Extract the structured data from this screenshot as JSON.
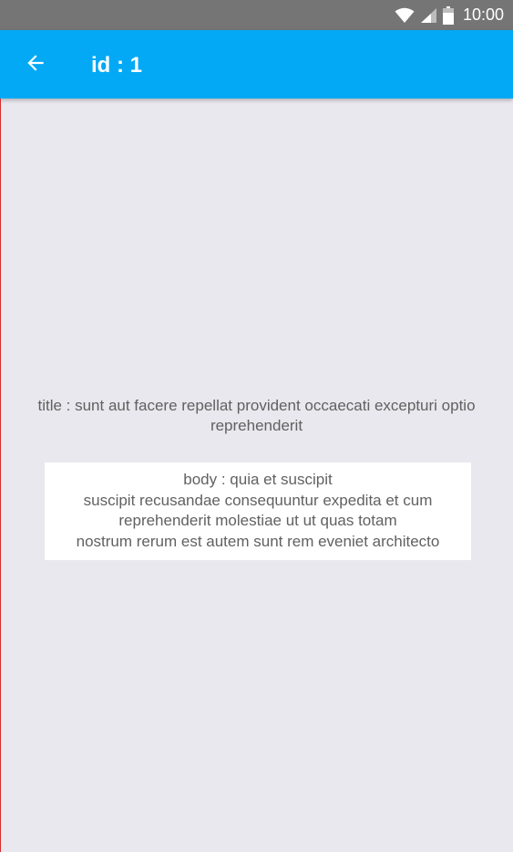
{
  "status_bar": {
    "time": "10:00",
    "icons": [
      "wifi-icon",
      "signal-icon",
      "battery-icon"
    ]
  },
  "app_bar": {
    "title": "id : 1",
    "back_icon": "arrow-back-icon",
    "background": "#03a9f4"
  },
  "post": {
    "title": "title : sunt aut facere repellat provident occaecati excepturi optio reprehenderit",
    "body_lines": [
      "body : quia et suscipit",
      "suscipit recusandae consequuntur expedita et cum",
      "reprehenderit molestiae ut ut quas totam",
      "nostrum rerum est autem sunt rem eveniet architecto"
    ]
  },
  "colors": {
    "status_bar": "#757575",
    "background": "#e9e8ee",
    "text": "#616161",
    "card": "#ffffff"
  }
}
